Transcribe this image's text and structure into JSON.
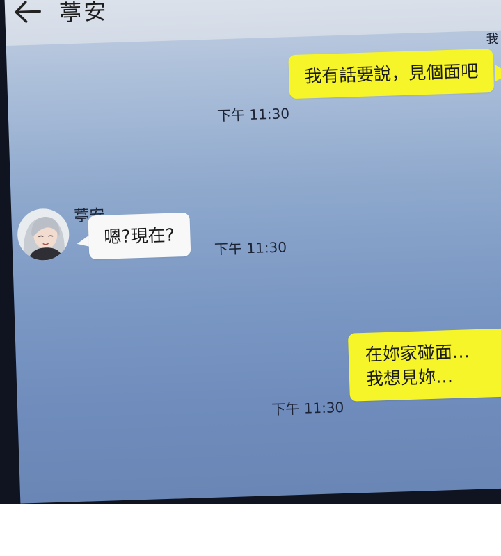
{
  "header": {
    "back_icon": "arrow-left-icon",
    "title": "葶安"
  },
  "messages": [
    {
      "side": "right",
      "sender": "我",
      "text": "我有話要說，見個面吧",
      "time": "下午 11:30"
    },
    {
      "side": "left",
      "sender": "葶安",
      "text": "嗯?現在?",
      "time": "下午 11:30"
    },
    {
      "side": "right",
      "lines": [
        "在妳家碰面…",
        "我想見妳…"
      ],
      "time": "下午 11:30"
    }
  ],
  "colors": {
    "my_bubble": "#f6f52a",
    "their_bubble": "#f8f8f8",
    "header": "#dfe4ec"
  }
}
